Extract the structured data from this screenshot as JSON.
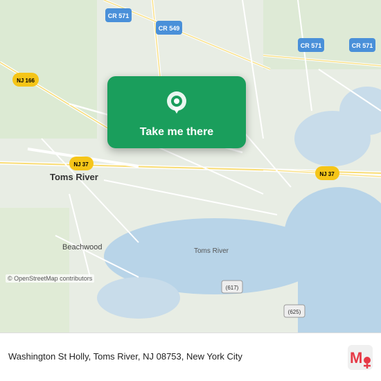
{
  "map": {
    "background_color": "#e8ede8",
    "credit": "© OpenStreetMap contributors"
  },
  "card": {
    "button_label": "Take me there",
    "background_color": "#1a9e5c"
  },
  "bottom_bar": {
    "address": "Washington St Holly, Toms River, NJ 08753, New\nYork City"
  },
  "moovit": {
    "label": "moovit"
  }
}
